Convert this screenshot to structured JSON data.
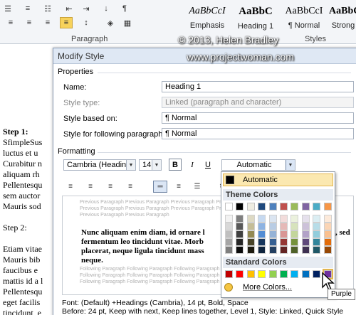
{
  "ribbon": {
    "paragraph_group_label": "Paragraph",
    "styles_group_label": "Styles",
    "buttons": [
      "bullets",
      "numbering",
      "multilevel",
      "decrease-indent",
      "increase-indent",
      "sort",
      "show-marks",
      "align-left",
      "center",
      "align-right",
      "justify",
      "line-spacing",
      "shading",
      "borders"
    ],
    "styles": [
      {
        "sample": "AaBbCcI",
        "name": "Emphasis",
        "style": "italic"
      },
      {
        "sample": "AaBbC",
        "name": "Heading 1",
        "style": "bold"
      },
      {
        "sample": "AaBbCcI",
        "name": "¶ Normal",
        "style": "normal"
      },
      {
        "sample": "AaBbCcI",
        "name": "Strong",
        "style": "bold"
      }
    ],
    "pilcrow": "¶"
  },
  "watermark": {
    "line1": "© 2013, Helen Bradley",
    "line2": "www.projectwoman.com"
  },
  "document": {
    "lines": [
      {
        "text": "Step 1:",
        "bold": true
      },
      {
        "text": "SfimpleSus"
      },
      {
        "text": "luctus et u"
      },
      {
        "text": "Curabitur n"
      },
      {
        "text": "aliquam rh"
      },
      {
        "text": "Pellentesqu"
      },
      {
        "text": "sem auctor"
      },
      {
        "text": "Mauris sod"
      },
      {
        "text": ""
      },
      {
        "text": "Step 2:"
      },
      {
        "text": ""
      },
      {
        "text": "Etiam vitae"
      },
      {
        "text": "Mauris bib"
      },
      {
        "text": "faucibus e"
      },
      {
        "text": "mattis id a l"
      },
      {
        "text": "Pellentesqu"
      },
      {
        "text": "eget facilis"
      },
      {
        "text": "tincidunt, e"
      }
    ]
  },
  "dialog": {
    "title": "Modify Style",
    "properties_label": "Properties",
    "name_label": "Name:",
    "name_value": "Heading 1",
    "style_type_label": "Style type:",
    "style_type_value": "Linked (paragraph and character)",
    "based_on_label": "Style based on:",
    "based_on_value": "¶  Normal",
    "following_label": "Style for following paragraph:",
    "following_value": "¶  Normal",
    "formatting_label": "Formatting",
    "font_value": "Cambria (Headings)",
    "size_value": "14",
    "bold_label": "B",
    "italic_label": "I",
    "underline_label": "U",
    "color_value": "Automatic",
    "preview": {
      "previous_lines": [
        "Previous Paragraph Previous Paragraph Previous Paragraph Previous Paragraph Previous Paragraph",
        "Previous Paragraph Previous Paragraph Previous Paragraph Previous Paragraph Previous Paragraph",
        "Previous Paragraph Previous Paragraph"
      ],
      "sample_lines": [
        "Nunc aliquam enim diam, id ornare l",
        "fermentum leo tincidunt vitae. Morb",
        "placerat, neque ligula tincidunt mass",
        "neque."
      ],
      "sample_tail": ", sed",
      "following_lines": [
        "Following Paragraph Following Paragraph Following Paragraph Following Paragraph Following Paragraph",
        "Following Paragraph Following Paragraph Following Paragraph Following Paragraph Following Paragraph",
        "Following Paragraph Following Paragraph Following Paragraph Following Paragraph Following Paragraph"
      ]
    },
    "status_line1": "Font: (Default) +Headings (Cambria), 14 pt, Bold, Space",
    "status_line2": "Before:  24 pt, Keep with next, Keep lines together, Level 1, Style: Linked, Quick Style"
  },
  "palette": {
    "automatic_label": "Automatic",
    "theme_label": "Theme Colors",
    "standard_label": "Standard Colors",
    "more_label": "More Colors...",
    "theme_top": [
      "#ffffff",
      "#000000",
      "#eeece1",
      "#1f497d",
      "#4f81bd",
      "#c0504d",
      "#9bbb59",
      "#8064a2",
      "#4bacc6",
      "#f79646"
    ],
    "theme_shades": [
      [
        "#f2f2f2",
        "#7f7f7f",
        "#ddd9c3",
        "#c6d9f0",
        "#dbe5f1",
        "#f2dcdb",
        "#ebf1dd",
        "#e5e0ec",
        "#dbeef3",
        "#fdeada"
      ],
      [
        "#d8d8d8",
        "#595959",
        "#c4bd97",
        "#8db3e2",
        "#b8cce4",
        "#e5b9b7",
        "#d7e3bc",
        "#ccc1d9",
        "#b7dde8",
        "#fbd5b5"
      ],
      [
        "#bfbfbf",
        "#3f3f3f",
        "#938953",
        "#548dd4",
        "#95b3d7",
        "#d99694",
        "#c3d69b",
        "#b2a2c7",
        "#92cddc",
        "#fac08f"
      ],
      [
        "#a5a5a5",
        "#262626",
        "#494429",
        "#17365d",
        "#366092",
        "#953734",
        "#76923c",
        "#5f497a",
        "#31859b",
        "#e36c09"
      ],
      [
        "#7f7f7f",
        "#0c0c0c",
        "#1d1b10",
        "#0f243e",
        "#244061",
        "#632423",
        "#4f6128",
        "#3f3151",
        "#205867",
        "#974806"
      ]
    ],
    "standard": [
      "#c00000",
      "#ff0000",
      "#ffc000",
      "#ffff00",
      "#92d050",
      "#00b050",
      "#00b0f0",
      "#0070c0",
      "#002060",
      "#7030a0"
    ],
    "tooltip": "Purple"
  }
}
